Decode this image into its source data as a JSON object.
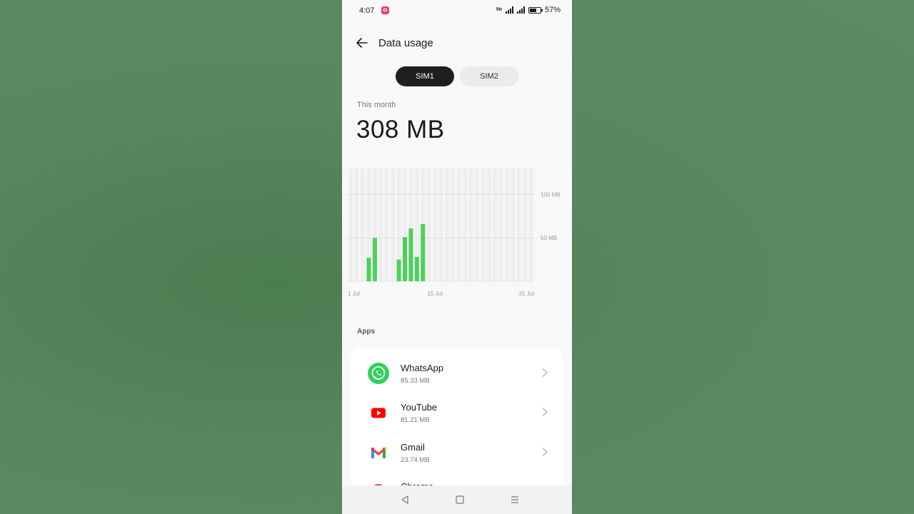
{
  "status_bar": {
    "time": "4:07",
    "volte": "Vo",
    "battery_percent": "57%"
  },
  "header": {
    "title": "Data usage"
  },
  "sim_tabs": [
    {
      "label": "SIM1",
      "active": true
    },
    {
      "label": "SIM2",
      "active": false
    }
  ],
  "summary": {
    "period_label": "This month",
    "total": "308 MB"
  },
  "chart_data": {
    "type": "bar",
    "days": 31,
    "x_tick_labels": [
      "1 Jul",
      "15 Jul",
      "31 Jul"
    ],
    "y_tick_labels": [
      "100 MB",
      "50 MB"
    ],
    "ylim": [
      0,
      130
    ],
    "values": [
      0,
      0,
      0,
      27,
      50,
      0,
      0,
      0,
      25,
      51,
      61,
      28,
      66,
      0,
      0,
      0,
      0,
      0,
      0,
      0,
      0,
      0,
      0,
      0,
      0,
      0,
      0,
      0,
      0,
      0,
      0
    ],
    "bar_color": "#4cd15d",
    "grid": true
  },
  "apps_section": {
    "label": "Apps",
    "items": [
      {
        "name": "WhatsApp",
        "usage": "85.33 MB",
        "icon": "whatsapp-icon"
      },
      {
        "name": "YouTube",
        "usage": "81.21 MB",
        "icon": "youtube-icon"
      },
      {
        "name": "Gmail",
        "usage": "23.74 MB",
        "icon": "gmail-icon"
      },
      {
        "name": "Chrome",
        "usage": "",
        "icon": "chrome-icon"
      }
    ]
  },
  "colors": {
    "accent_green": "#4cd15d",
    "sim_active_bg": "#1f1f1f"
  }
}
